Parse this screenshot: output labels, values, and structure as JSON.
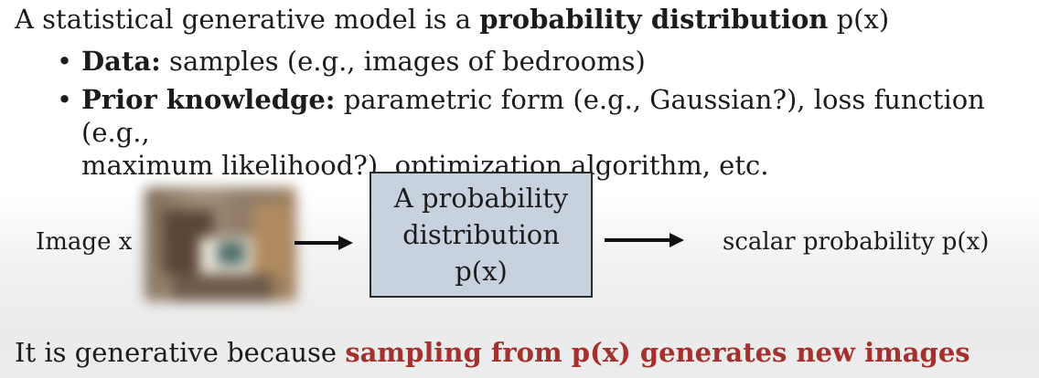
{
  "slide": {
    "intro": {
      "prefix": "A statistical generative model is a ",
      "bold": "probability distribution",
      "suffix": " p(x)"
    },
    "bullets": [
      {
        "marker": "•",
        "bold": "Data:",
        "text": " samples (e.g., images of bedrooms)",
        "continuation": ""
      },
      {
        "marker": "•",
        "bold": "Prior knowledge:",
        "text": " parametric form (e.g., Gaussian?), loss function (e.g.,",
        "continuation": "maximum likelihood?), optimization algorithm, etc."
      }
    ],
    "diagram": {
      "input_label": "Image x",
      "box_lines": [
        "A probability",
        "distribution",
        "p(x)"
      ],
      "output_label": "scalar probability p(x)",
      "box_color": "#c8d2df"
    },
    "conclusion": {
      "prefix": "It is generative because ",
      "highlight": "sampling from p(x) generates new images"
    },
    "colors": {
      "accent": "#a3312d",
      "text": "#1c1c1c"
    }
  }
}
